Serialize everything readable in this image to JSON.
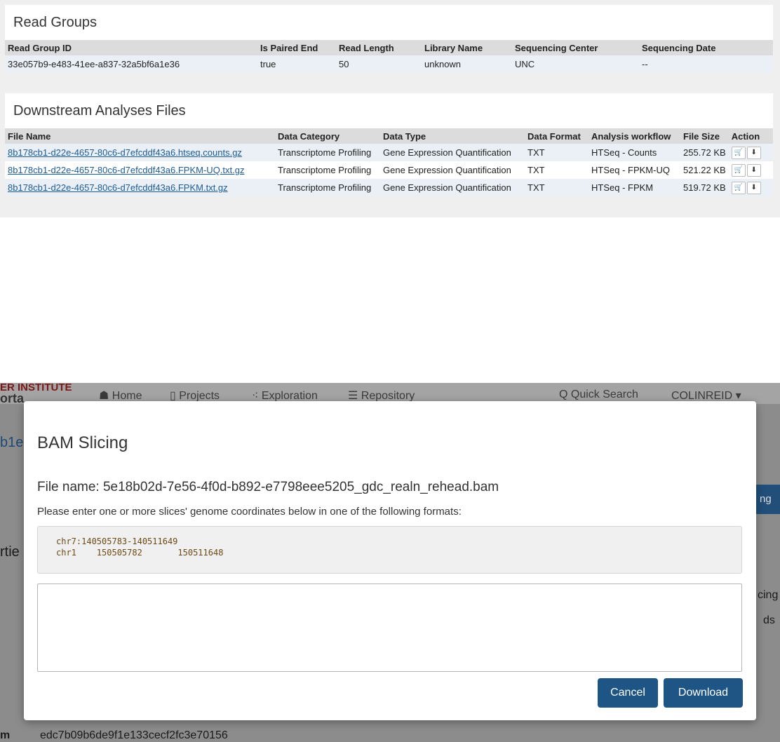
{
  "read_groups": {
    "title": "Read Groups",
    "columns": [
      "Read Group ID",
      "Is Paired End",
      "Read Length",
      "Library Name",
      "Sequencing Center",
      "Sequencing Date"
    ],
    "rows": [
      [
        "33e057b9-e483-41ee-a837-32a5bf6a1e36",
        "true",
        "50",
        "unknown",
        "UNC",
        "--"
      ]
    ]
  },
  "downstream": {
    "title": "Downstream Analyses Files",
    "columns": [
      "File Name",
      "Data Category",
      "Data Type",
      "Data Format",
      "Analysis workflow",
      "File Size",
      "Action"
    ],
    "rows": [
      [
        "8b178cb1-d22e-4657-80c6-d7efcddf43a6.htseq.counts.gz",
        "Transcriptome Profiling",
        "Gene Expression Quantification",
        "TXT",
        "HTSeq - Counts",
        "255.72 KB"
      ],
      [
        "8b178cb1-d22e-4657-80c6-d7efcddf43a6.FPKM-UQ.txt.gz",
        "Transcriptome Profiling",
        "Gene Expression Quantification",
        "TXT",
        "HTSeq - FPKM-UQ",
        "521.22 KB"
      ],
      [
        "8b178cb1-d22e-4657-80c6-d7efcddf43a6.FPKM.txt.gz",
        "Transcriptome Profiling",
        "Gene Expression Quantification",
        "TXT",
        "HTSeq - FPKM",
        "519.72 KB"
      ]
    ],
    "action_icons": [
      "cart-icon",
      "download-icon"
    ]
  },
  "nav": {
    "brand_line1": "ER INSTITUTE",
    "brand_line2": "orta",
    "home": "☗ Home",
    "projects": "▯ Projects",
    "exploration": "⁖ Exploration",
    "repository": "☰ Repository",
    "quick_search": "Q Quick Search",
    "user": "COLINREID ▾"
  },
  "behind": {
    "title_frag": "b1e",
    "props_frag": "rtie",
    "blue_btn_frag": "ng",
    "right_frag1": "cing",
    "right_frag2": "ds",
    "bottom_label": "m",
    "bottom_value": "edc7b09b6de9f1e133cecf2fc3e70156"
  },
  "modal": {
    "title": "BAM Slicing",
    "file_name": "File name: 5e18b02d-7e56-4f0d-b892-e7798eee5205_gdc_realn_rehead.bam",
    "instructions": "Please enter one or more slices' genome coordinates below in one of the following formats:",
    "example_line1": "chr7:140505783-140511649",
    "example_line2": "chr1    150505782       150511648",
    "textarea_value": "",
    "cancel_label": "Cancel",
    "download_label": "Download"
  },
  "colors": {
    "accent": "#1e5585",
    "link": "#1d5b95",
    "brand": "#7a1818"
  }
}
